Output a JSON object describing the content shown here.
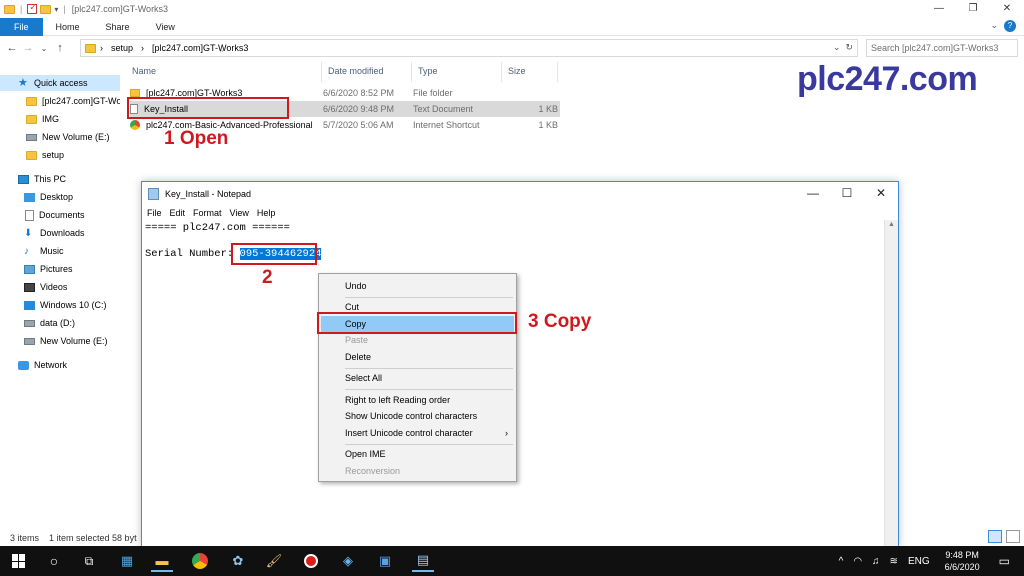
{
  "explorer": {
    "title": "[plc247.com]GT-Works3",
    "ribbon_tabs": [
      "File",
      "Home",
      "Share",
      "View"
    ],
    "address": {
      "crumbs": [
        "setup",
        "[plc247.com]GT-Works3"
      ]
    },
    "search_placeholder": "Search [plc247.com]GT-Works3",
    "nav": [
      {
        "label": "Quick access",
        "icon": "star-icon",
        "selected": true
      },
      {
        "label": "[plc247.com]GT-Wo",
        "icon": "folder-icon"
      },
      {
        "label": "IMG",
        "icon": "folder-icon"
      },
      {
        "label": "New Volume (E:)",
        "icon": "drive-icon"
      },
      {
        "label": "setup",
        "icon": "folder-icon"
      },
      {
        "label": "This PC",
        "icon": "pc-icon"
      },
      {
        "label": "Desktop",
        "icon": "desktop-icon"
      },
      {
        "label": "Documents",
        "icon": "documents-icon"
      },
      {
        "label": "Downloads",
        "icon": "downloads-icon"
      },
      {
        "label": "Music",
        "icon": "music-icon"
      },
      {
        "label": "Pictures",
        "icon": "pictures-icon"
      },
      {
        "label": "Videos",
        "icon": "videos-icon"
      },
      {
        "label": "Windows 10 (C:)",
        "icon": "windows-drive-icon"
      },
      {
        "label": "data (D:)",
        "icon": "drive-icon"
      },
      {
        "label": "New Volume (E:)",
        "icon": "drive-icon"
      },
      {
        "label": "Network",
        "icon": "network-icon"
      }
    ],
    "columns": [
      "Name",
      "Date modified",
      "Type",
      "Size"
    ],
    "files": [
      {
        "name": "[plc247.com]GT-Works3",
        "date": "6/6/2020 8:52 PM",
        "type": "File folder",
        "size": "",
        "icon": "folder-icon"
      },
      {
        "name": "Key_Install",
        "date": "6/6/2020 9:48 PM",
        "type": "Text Document",
        "size": "1 KB",
        "icon": "text-file-icon"
      },
      {
        "name": "plc247.com-Basic-Advanced-Professional",
        "date": "5/7/2020 5:06 AM",
        "type": "Internet Shortcut",
        "size": "1 KB",
        "icon": "chrome-shortcut-icon"
      }
    ],
    "status": {
      "count": "3 items",
      "selected": "1 item selected  58 byt"
    }
  },
  "annotations": {
    "step1": "1 Open",
    "step2": "2",
    "step3": "3 Copy",
    "brand": "plc247.com"
  },
  "notepad": {
    "title": "Key_Install - Notepad",
    "menu": [
      "File",
      "Edit",
      "Format",
      "View",
      "Help"
    ],
    "line1": "===== plc247.com ======",
    "serial_label": "Serial Number: ",
    "serial_value": "095-394462924"
  },
  "context_menu": {
    "items": [
      "Undo",
      "Cut",
      "Copy",
      "Paste",
      "Delete",
      "Select All",
      "Right to left Reading order",
      "Show Unicode control characters",
      "Insert Unicode control character",
      "Open IME",
      "Reconversion"
    ],
    "submenu_arrow": "›"
  },
  "taskbar": {
    "time": "9:48 PM",
    "date": "6/6/2020",
    "lang": "ENG"
  }
}
